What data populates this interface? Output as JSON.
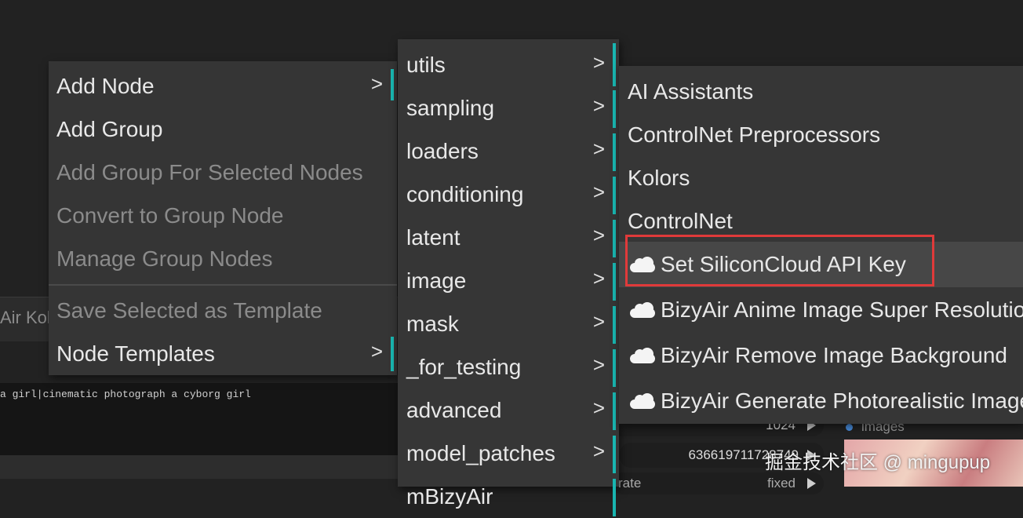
{
  "background": {
    "node_label": "Air Kolo",
    "prompt_text": "a girl|cinematic photograph a cyborg girl",
    "widgets": {
      "width_value": "1024",
      "seed_value": "636619711728749",
      "control_label": "rate",
      "control_value": "fixed"
    },
    "images_label": "images",
    "watermark": "掘金技术社区 @ mingupup"
  },
  "context_menu": {
    "items": [
      {
        "label": "Add Node",
        "enabled": true,
        "has_submenu": true
      },
      {
        "label": "Add Group",
        "enabled": true,
        "has_submenu": false
      },
      {
        "label": "Add Group For Selected Nodes",
        "enabled": false,
        "has_submenu": false
      },
      {
        "label": "Convert to Group Node",
        "enabled": false,
        "has_submenu": false
      },
      {
        "label": "Manage Group Nodes",
        "enabled": false,
        "has_submenu": false
      },
      {
        "label": "Save Selected as Template",
        "enabled": false,
        "has_submenu": false
      },
      {
        "label": "Node Templates",
        "enabled": true,
        "has_submenu": true
      }
    ],
    "submenu_chevron": ">"
  },
  "add_node_menu": {
    "items": [
      {
        "label": "utils"
      },
      {
        "label": "sampling"
      },
      {
        "label": "loaders"
      },
      {
        "label": "conditioning"
      },
      {
        "label": "latent"
      },
      {
        "label": "image"
      },
      {
        "label": "mask"
      },
      {
        "label": "_for_testing"
      },
      {
        "label": "advanced"
      },
      {
        "label": "model_patches"
      },
      {
        "label": "mBizyAir"
      }
    ]
  },
  "category_menu": {
    "items": [
      {
        "label": "AI Assistants",
        "icon": null
      },
      {
        "label": "ControlNet Preprocessors",
        "icon": null
      },
      {
        "label": "Kolors",
        "icon": null
      },
      {
        "label": "ControlNet",
        "icon": null
      },
      {
        "label": "Set SiliconCloud API Key",
        "icon": "cloud-icon",
        "highlighted": true
      },
      {
        "label": "BizyAir Anime Image Super Resolution",
        "icon": "cloud-icon"
      },
      {
        "label": "BizyAir Remove Image Background",
        "icon": "cloud-icon"
      },
      {
        "label": "BizyAir Generate Photorealistic Images",
        "icon": "cloud-icon"
      }
    ]
  },
  "colors": {
    "accent": "#19b5b0",
    "annotation_box": "#e03a3a",
    "menu_bg": "#353535"
  }
}
